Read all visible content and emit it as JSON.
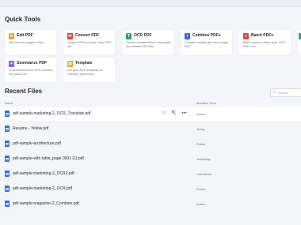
{
  "quick_tools": {
    "title": "Quick Tools",
    "tools": [
      {
        "name": "Edit PDF",
        "desc": "Edit text and images in files.",
        "color": "#f0a020",
        "icon": "edit-icon"
      },
      {
        "name": "Convert PDF",
        "desc": "Convert PDFs to Word, Excel, PPT, etc.",
        "color": "#e0453a",
        "icon": "convert-icon"
      },
      {
        "name": "OCR PDF",
        "desc": "Convert scanned files to searchable and editable PDF files.",
        "color": "#23a86d",
        "icon": "ocr-icon"
      },
      {
        "name": "Combine PDFs",
        "desc": "Combine multiple files into a single PDF.",
        "color": "#2a6ee8",
        "icon": "combine-icon"
      },
      {
        "name": "Batch PDFs",
        "desc": "Batch convert, create, print, OCR PDFs, etc.",
        "color": "#e0453a",
        "icon": "batch-icon"
      },
      {
        "name": "",
        "desc": "",
        "color": "#23a86d",
        "icon": "partial-tool-icon"
      },
      {
        "name": "Summarize PDF",
        "desc": "AI summarizes your PDF overview, key points, etc.",
        "color": "#8b5cf6",
        "icon": "summarize-icon"
      },
      {
        "name": "Template",
        "desc": "Get good PDF templates for resumes, posters etc.",
        "color": "#f0a020",
        "icon": "template-icon"
      }
    ]
  },
  "recent_files": {
    "title": "Recent Files",
    "col_name": "Name",
    "col_modified": "Modified Time",
    "search_placeholder": "Search",
    "files": [
      {
        "name": "pdf-sample-marketing-2_OCR_Translate.pdf",
        "modified": "Earlier"
      },
      {
        "name": "Resume - Yellow.pdf",
        "modified": "Today"
      },
      {
        "name": "pdf-sample-architecture.pdf",
        "modified": "Earlier"
      },
      {
        "name": "pdf-sample-with table_page 0001 (1).pdf",
        "modified": "Yesterday"
      },
      {
        "name": "pdf-sample-marketing-2_OCR2.pdf",
        "modified": "Last Week"
      },
      {
        "name": "pdf-sample-marketing-2_OCR.pdf",
        "modified": "Earlier"
      },
      {
        "name": "pdf-sample-magazine-2_Combine.pdf",
        "modified": "Earlier"
      }
    ]
  }
}
